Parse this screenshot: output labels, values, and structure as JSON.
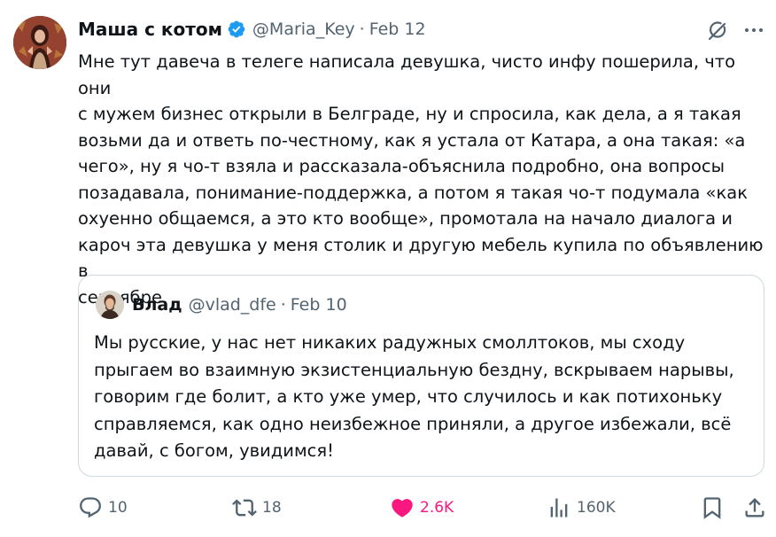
{
  "author": {
    "name": "Маша с котом",
    "handle": "@Maria_Key",
    "separator": "·",
    "date": "Feb 12"
  },
  "tweet_text": "Мне тут давеча в телеге написала девушка, чисто инфу пошерила, что они\nс мужем бизнес открыли в Белграде, ну и спросила, как дела, а я такая\nвозьми да и ответь по-честному, как я устала от Катара, а она такая: «а\nчего», ну я чо-т взяла и рассказала-объяснила подробно, она вопросы\nпозадавала, понимание-поддержка, а потом я такая чо-т подумала «как\nохуенно общаемся, а это кто вообще», промотала на начало диалога и\nкароч эта девушка у меня столик и другую мебель купила по объявлению в\nсентябре",
  "quote": {
    "name": "Влад",
    "handle": "@vlad_dfe",
    "separator": "·",
    "date": "Feb 10",
    "text": "Мы русские, у нас нет никаких радужных смоллтоков, мы сходу\nпрыгаем во взаимную экзистенциальную бездну, вскрываем нарывы,\nговорим где болит, а кто уже умер, что случилось и как потихоньку\nсправляемся, как одно неизбежное приняли, а другое избежали, всё\nдавай, с богом, увидимся!"
  },
  "actions": {
    "replies": "10",
    "reposts": "18",
    "likes": "2.6K",
    "views": "160K"
  },
  "icons": {
    "verified": "verified-badge-icon",
    "grok": "grok-icon",
    "more": "more-dots-icon",
    "reply": "reply-icon",
    "repost": "repost-icon",
    "like": "heart-icon",
    "views": "views-chart-icon",
    "bookmark": "bookmark-icon",
    "share": "share-icon"
  },
  "colors": {
    "text": "#0f1419",
    "secondary": "#536471",
    "verified": "#1d9bf0",
    "like": "#f91880",
    "border": "#cfd9de"
  }
}
